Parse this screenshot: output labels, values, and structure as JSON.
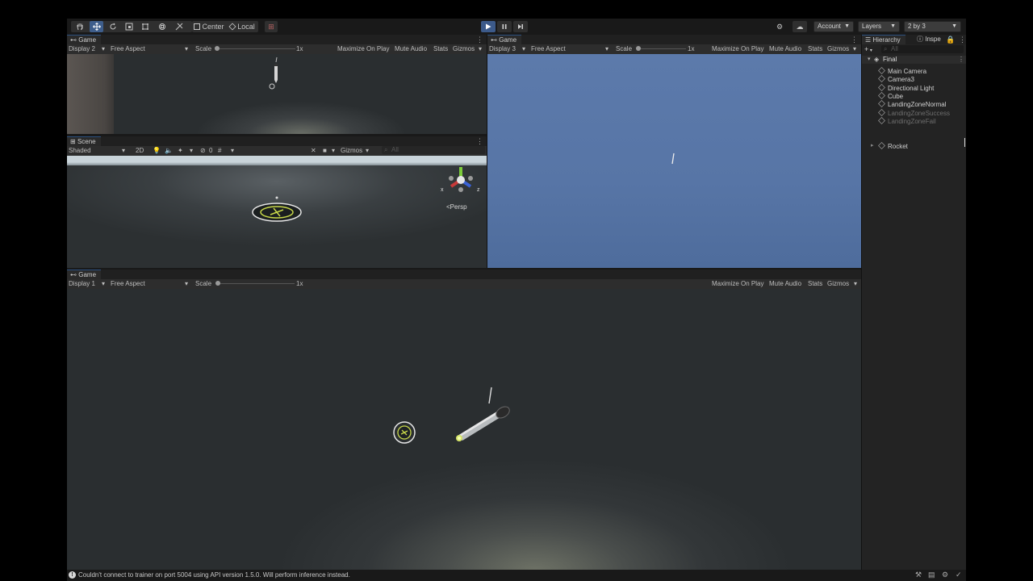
{
  "toolbar": {
    "tools": [
      "hand-tool",
      "move-tool",
      "rotate-tool",
      "scale-tool",
      "rect-tool",
      "transform-tool",
      "custom-tool"
    ],
    "pivot_center": "Center",
    "pivot_local": "Local",
    "account": "Account",
    "layers": "Layers",
    "layout": "2 by 3"
  },
  "game_top_left": {
    "tab": "Game",
    "display": "Display 2",
    "aspect": "Free Aspect",
    "scale_label": "Scale",
    "scale_value": "1x",
    "maximize": "Maximize On Play",
    "mute": "Mute Audio",
    "stats": "Stats",
    "gizmos": "Gizmos"
  },
  "scene": {
    "tab": "Scene",
    "shading": "Shaded",
    "mode_2d": "2D",
    "hidden_count": "0",
    "gizmos": "Gizmos",
    "search_placeholder": "All",
    "persp": "Persp",
    "axis_x": "x",
    "axis_z": "z"
  },
  "game_right": {
    "tab": "Game",
    "display": "Display 3",
    "aspect": "Free Aspect",
    "scale_label": "Scale",
    "scale_value": "1x",
    "maximize": "Maximize On Play",
    "mute": "Mute Audio",
    "stats": "Stats",
    "gizmos": "Gizmos"
  },
  "game_bottom": {
    "tab": "Game",
    "display": "Display 1",
    "aspect": "Free Aspect",
    "scale_label": "Scale",
    "scale_value": "1x",
    "maximize": "Maximize On Play",
    "mute": "Mute Audio",
    "stats": "Stats",
    "gizmos": "Gizmos"
  },
  "hierarchy": {
    "tab": "Hierarchy",
    "inspector_tab": "Inspe",
    "search_placeholder": "All",
    "scene_name": "Final",
    "items": [
      {
        "label": "Main Camera",
        "dim": false
      },
      {
        "label": "Camera3",
        "dim": false
      },
      {
        "label": "Directional Light",
        "dim": false
      },
      {
        "label": "Cube",
        "dim": false
      },
      {
        "label": "LandingZoneNormal",
        "dim": false
      },
      {
        "label": "LandingZoneSuccess",
        "dim": true
      },
      {
        "label": "LandingZoneFail",
        "dim": true
      }
    ],
    "rocket": "Rocket"
  },
  "status": {
    "message": "Couldn't connect to trainer on port 5004 using API version 1.5.0. Will perform inference instead."
  },
  "colors": {
    "accent": "#3e5e8c",
    "play_active": "#3c5a8a",
    "sky_blue": "#5a77a8"
  }
}
